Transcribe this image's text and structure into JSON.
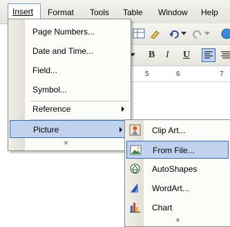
{
  "menubar": {
    "items": [
      "Insert",
      "Format",
      "Tools",
      "Table",
      "Window",
      "Help"
    ]
  },
  "toolbar": {
    "bold": "B",
    "italic": "I",
    "underline": "U"
  },
  "ruler": {
    "ticks": [
      "5",
      "6",
      "7"
    ]
  },
  "insert_menu": {
    "items": [
      {
        "label": "Page Numbers...",
        "submenu": false
      },
      {
        "label": "Date and Time...",
        "submenu": false
      },
      {
        "label": "Field...",
        "submenu": false
      },
      {
        "label": "Symbol...",
        "submenu": false
      },
      {
        "label": "Reference",
        "submenu": true
      },
      {
        "label": "Picture",
        "submenu": true,
        "highlighted": true
      }
    ],
    "expand_glyph": "»"
  },
  "picture_menu": {
    "items": [
      {
        "label": "Clip Art...",
        "icon": "clipart-icon"
      },
      {
        "label": "From File...",
        "icon": "from-file-icon",
        "highlighted": true
      },
      {
        "label": "AutoShapes",
        "icon": "autoshapes-icon"
      },
      {
        "label": "WordArt...",
        "icon": "wordart-icon"
      },
      {
        "label": "Chart",
        "icon": "chart-icon"
      }
    ],
    "expand_glyph": "»"
  },
  "colors": {
    "highlight_fill": "#c1d2ee",
    "highlight_border": "#316ac5",
    "menu_bg": "#fcfcf9"
  }
}
